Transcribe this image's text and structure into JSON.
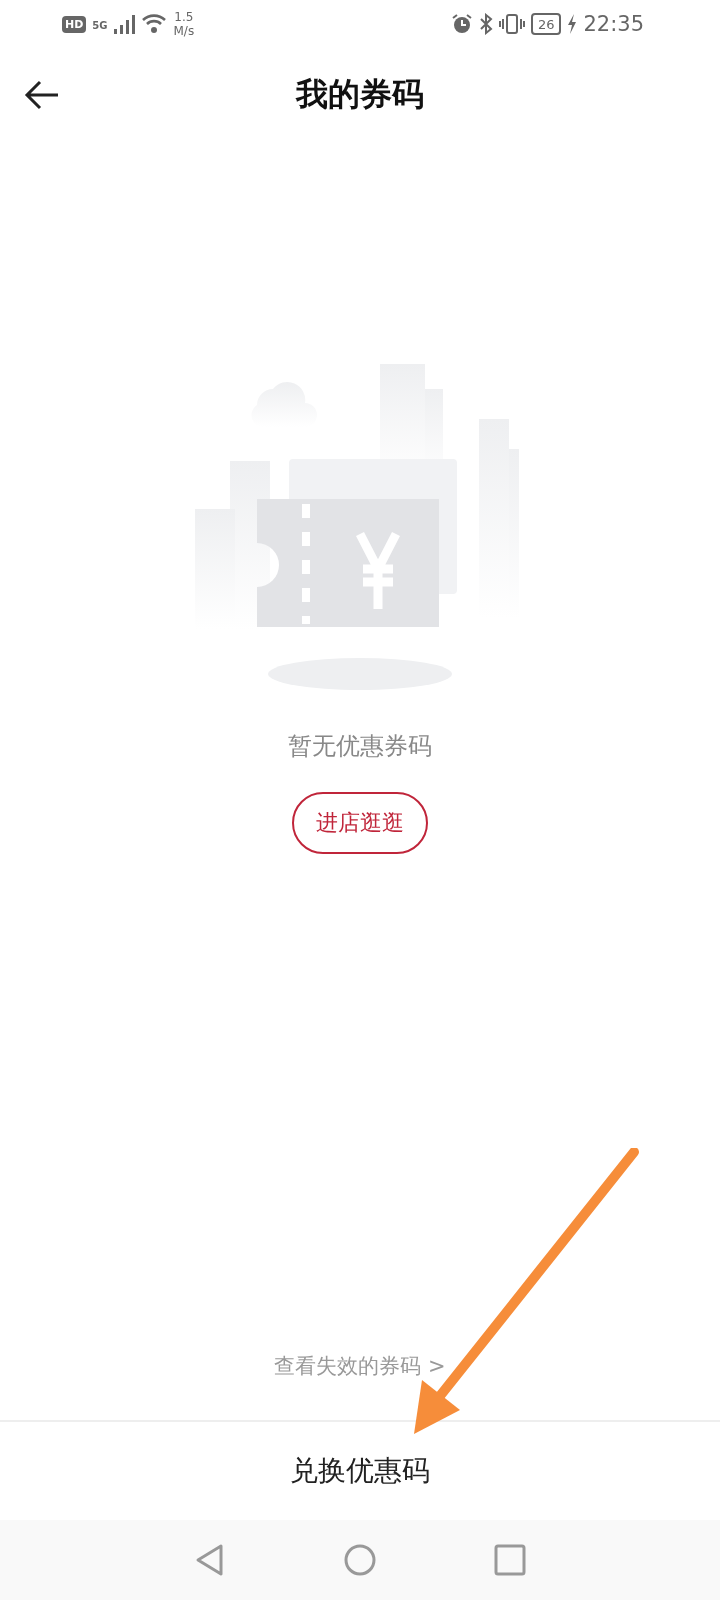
{
  "status_bar": {
    "hd": "HD",
    "network": "5G",
    "speed": "1.5",
    "speed_unit": "M/s",
    "battery": "26",
    "time": "22:35"
  },
  "header": {
    "title": "我的券码"
  },
  "empty_state": {
    "message": "暂无优惠券码",
    "button": "进店逛逛"
  },
  "expired_link": "查看失效的券码 >",
  "footer_button": "兑换优惠码",
  "annotation": {
    "kind": "arrow",
    "color": "#f68d3a"
  }
}
